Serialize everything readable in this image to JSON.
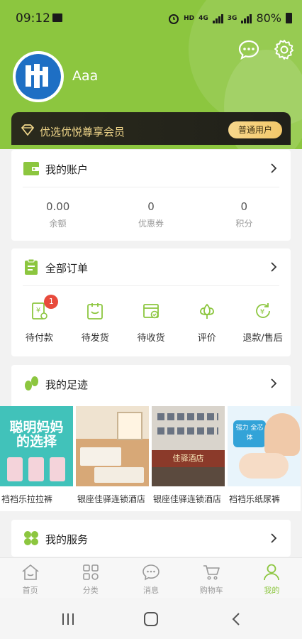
{
  "status_bar": {
    "time": "09:12",
    "hd": "HD",
    "net1": "4G",
    "net2": "3G",
    "battery": "80%"
  },
  "header": {
    "username": "Aaa",
    "icons": [
      "chat-bubble-icon",
      "gear-icon"
    ]
  },
  "vip": {
    "text": "优选优悦尊享会员",
    "badge": "普通用户"
  },
  "account": {
    "title": "我的账户",
    "stats": [
      {
        "value": "0.00",
        "label": "余额"
      },
      {
        "value": "0",
        "label": "优惠券"
      },
      {
        "value": "0",
        "label": "积分"
      }
    ]
  },
  "orders": {
    "title": "全部订单",
    "items": [
      {
        "label": "待付款",
        "badge": "1",
        "icon": "payment-pending-icon"
      },
      {
        "label": "待发货",
        "icon": "to-ship-icon"
      },
      {
        "label": "待收货",
        "icon": "to-receive-icon"
      },
      {
        "label": "评价",
        "icon": "review-flower-icon"
      },
      {
        "label": "退款/售后",
        "icon": "refund-icon"
      }
    ]
  },
  "footprint": {
    "title": "我的足迹",
    "items": [
      {
        "label": "裆裆乐拉拉裤",
        "image_text": "聪明妈妈的选择"
      },
      {
        "label": "银座佳驿连锁酒店"
      },
      {
        "label": "银座佳驿连锁酒店",
        "image_text": "佳驿酒店"
      },
      {
        "label": "裆裆乐纸尿裤",
        "image_text": "强力 全芯体"
      }
    ]
  },
  "service": {
    "title": "我的服务"
  },
  "tabbar": {
    "items": [
      {
        "label": "首页",
        "icon": "home-icon"
      },
      {
        "label": "分类",
        "icon": "category-icon"
      },
      {
        "label": "消息",
        "icon": "message-icon"
      },
      {
        "label": "购物车",
        "icon": "cart-icon"
      },
      {
        "label": "我的",
        "icon": "profile-icon",
        "active": true
      }
    ]
  },
  "colors": {
    "accent": "#8cc63f",
    "badge_red": "#e84a3c",
    "vip_gold": "#f0d68a"
  }
}
